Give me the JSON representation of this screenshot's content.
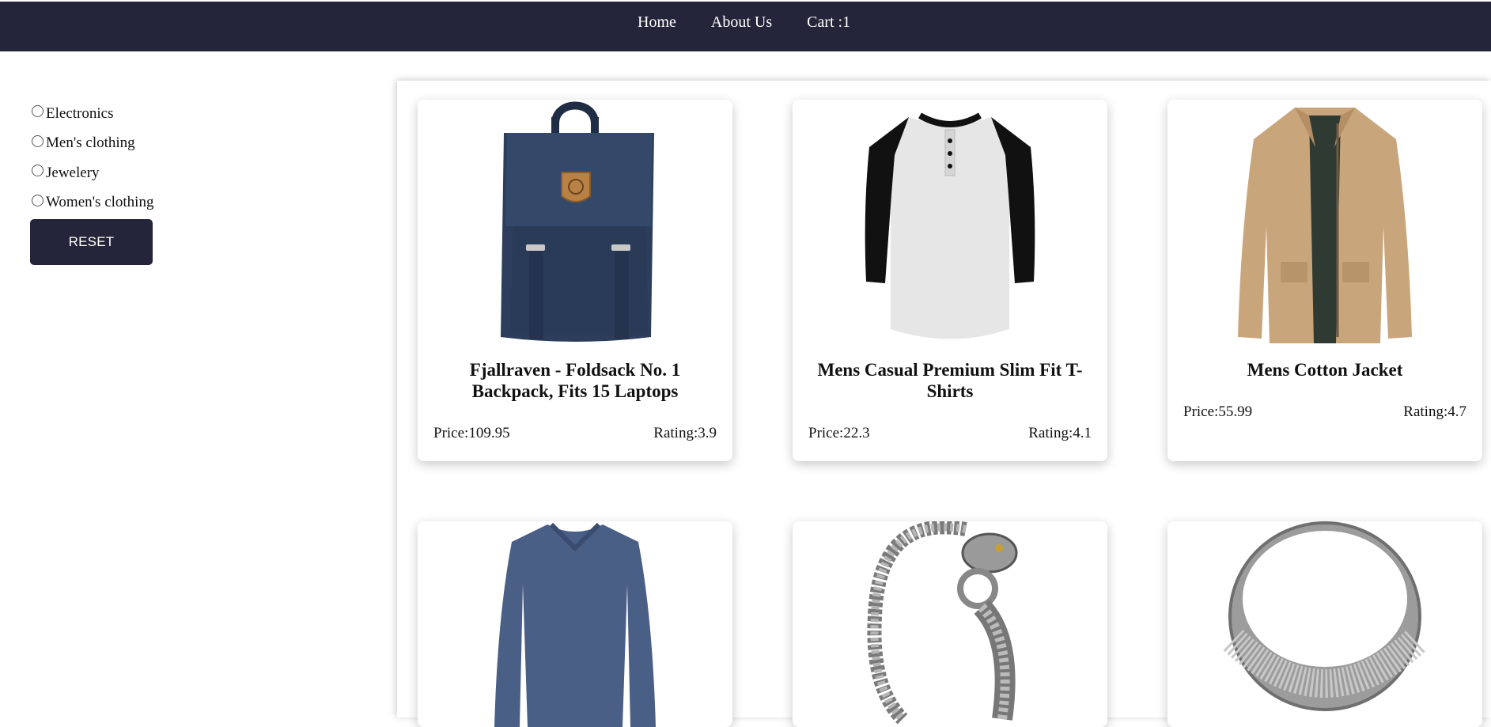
{
  "nav": {
    "home": "Home",
    "about": "About Us",
    "cart": "Cart :1"
  },
  "filters": {
    "options": [
      "Electronics",
      "Men's clothing",
      "Jewelery",
      "Women's clothing"
    ],
    "reset_label": "RESET"
  },
  "products": [
    {
      "title": "Fjallraven - Foldsack No. 1 Backpack, Fits 15 Laptops",
      "price": "Price:109.95",
      "rating": "Rating:3.9",
      "image": "backpack-image"
    },
    {
      "title": "Mens Casual Premium Slim Fit T-Shirts",
      "price": "Price:22.3",
      "rating": "Rating:4.1",
      "image": "tshirt-image"
    },
    {
      "title": "Mens Cotton Jacket",
      "price": "Price:55.99",
      "rating": "Rating:4.7",
      "image": "jacket-image"
    },
    {
      "title": "",
      "price": "",
      "rating": "",
      "image": "longsleeve-shirt-image"
    },
    {
      "title": "",
      "price": "",
      "rating": "",
      "image": "bracelet-image"
    },
    {
      "title": "",
      "price": "",
      "rating": "",
      "image": "ring-image"
    }
  ],
  "colors": {
    "navbar": "#24243a",
    "button": "#24243a"
  }
}
